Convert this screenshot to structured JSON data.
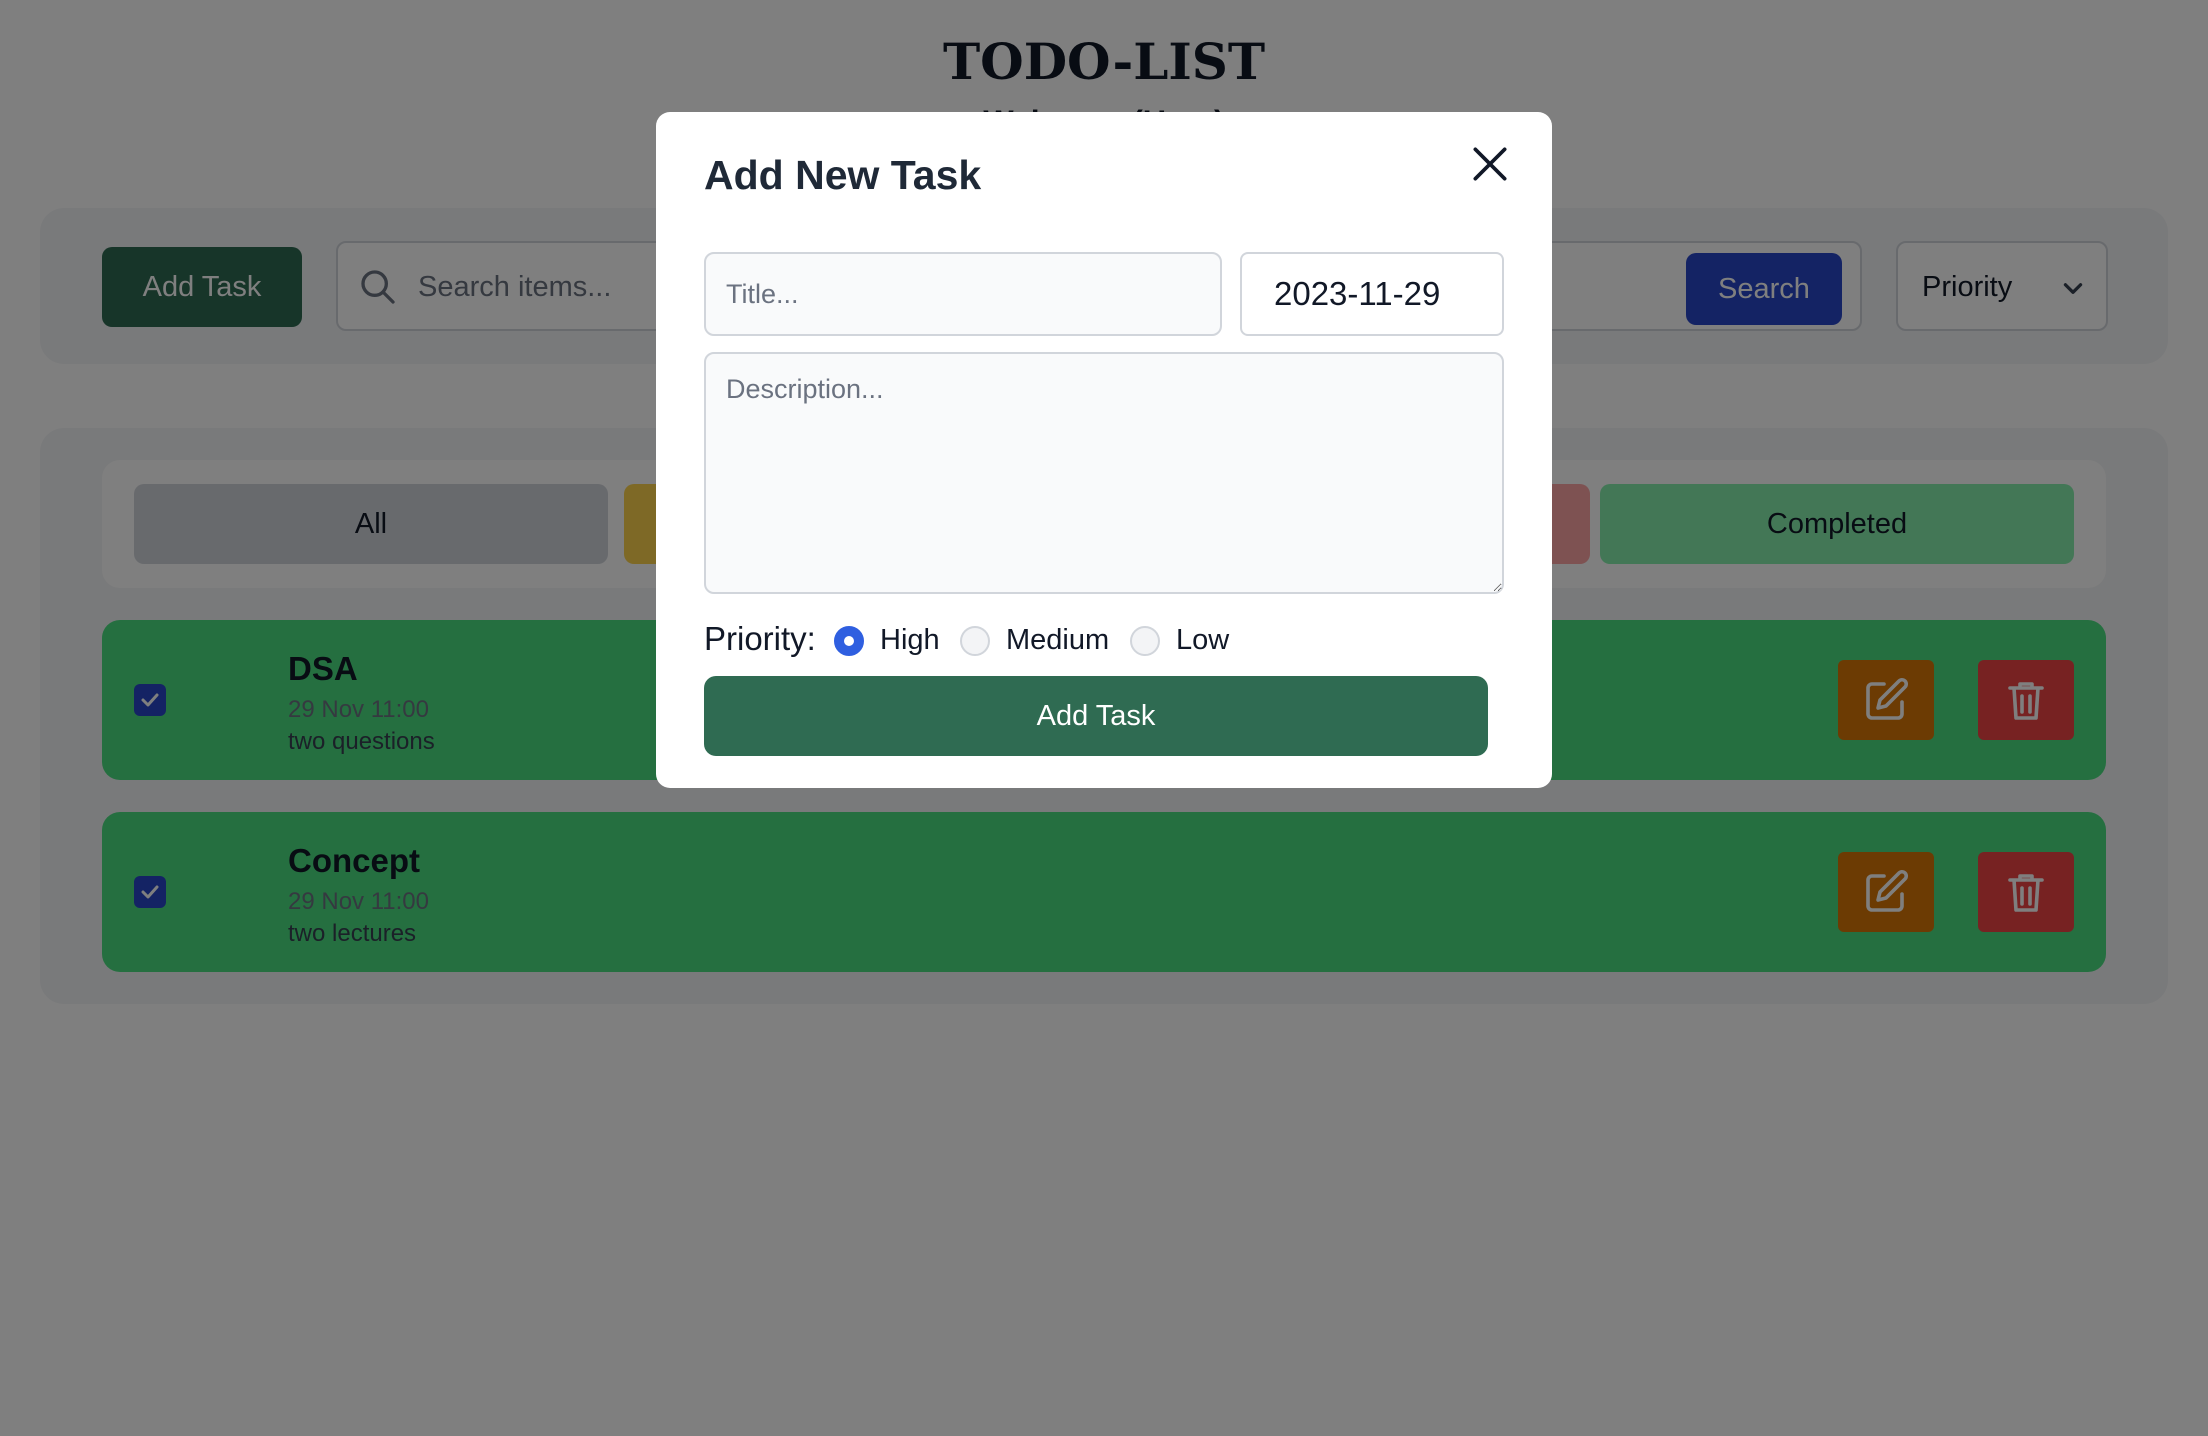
{
  "header": {
    "title": "TODO-LIST",
    "welcome": "Welcome (User)"
  },
  "toolbar": {
    "add_task_label": "Add Task",
    "search_placeholder": "Search items...",
    "search_button_label": "Search",
    "priority_select": {
      "selected": "Priority"
    }
  },
  "filters": {
    "tabs": [
      {
        "label": "All"
      },
      {
        "label": ""
      },
      {
        "label": ""
      },
      {
        "label": "Completed"
      }
    ]
  },
  "tasks": [
    {
      "title": "DSA",
      "date": "29 Nov 11:00",
      "description": "two questions",
      "completed": true
    },
    {
      "title": "Concept",
      "date": "29 Nov 11:00",
      "description": "two lectures",
      "completed": true
    }
  ],
  "modal": {
    "title": "Add New Task",
    "title_placeholder": "Title...",
    "date_value": "2023-11-29",
    "description_placeholder": "Description...",
    "priority_label": "Priority:",
    "priority_options": [
      {
        "label": "High",
        "selected": true
      },
      {
        "label": "Medium",
        "selected": false
      },
      {
        "label": "Low",
        "selected": false
      }
    ],
    "submit_label": "Add Task"
  },
  "colors": {
    "primary_green": "#2f6b52",
    "search_blue": "#2847c9",
    "task_bg": "#4ade80",
    "edit_orange": "#d97706",
    "delete_red": "#ef4444"
  }
}
